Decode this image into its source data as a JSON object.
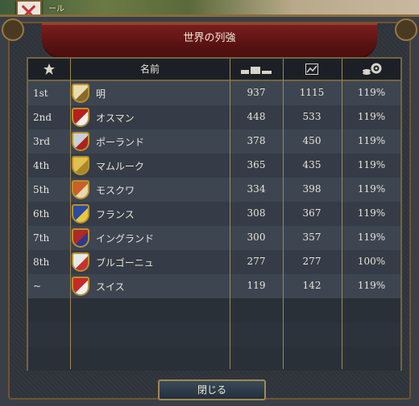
{
  "map": {
    "label": "ール"
  },
  "window": {
    "title": "世界の列強"
  },
  "table": {
    "columns": {
      "rank": "star-icon",
      "name": "名前",
      "score": "bars-icon",
      "development": "chart-icon",
      "modifier": "coins-gear-icon"
    },
    "rows": [
      {
        "rank": "1st",
        "name": "明",
        "v1": "937",
        "v2": "1115",
        "v3": "119%",
        "flag_color": "#e8dcb0",
        "flag_accent": "#8a6a2a"
      },
      {
        "rank": "2nd",
        "name": "オスマン",
        "v1": "448",
        "v2": "533",
        "v3": "119%",
        "flag_color": "#b8201c",
        "flag_accent": "#f0f0f0"
      },
      {
        "rank": "3rd",
        "name": "ポーランド",
        "v1": "378",
        "v2": "450",
        "v3": "119%",
        "flag_color": "#c8d0d8",
        "flag_accent": "#b02020"
      },
      {
        "rank": "4th",
        "name": "マムルーク",
        "v1": "365",
        "v2": "435",
        "v3": "119%",
        "flag_color": "#e0c050",
        "flag_accent": "#a88828"
      },
      {
        "rank": "5th",
        "name": "モスクワ",
        "v1": "334",
        "v2": "398",
        "v3": "119%",
        "flag_color": "#c86028",
        "flag_accent": "#e8d8b0"
      },
      {
        "rank": "6th",
        "name": "フランス",
        "v1": "308",
        "v2": "367",
        "v3": "119%",
        "flag_color": "#2a4ca0",
        "flag_accent": "#e8c840"
      },
      {
        "rank": "7th",
        "name": "イングランド",
        "v1": "300",
        "v2": "357",
        "v3": "119%",
        "flag_color": "#b02828",
        "flag_accent": "#2a3a90"
      },
      {
        "rank": "8th",
        "name": "ブルゴーニュ",
        "v1": "277",
        "v2": "277",
        "v3": "100%",
        "flag_color": "#e8e8e8",
        "flag_accent": "#c83030"
      },
      {
        "rank": "~",
        "name": "スイス",
        "v1": "119",
        "v2": "142",
        "v3": "119%",
        "flag_color": "#c82828",
        "flag_accent": "#f0f0f0"
      }
    ]
  },
  "buttons": {
    "close": "閉じる"
  }
}
